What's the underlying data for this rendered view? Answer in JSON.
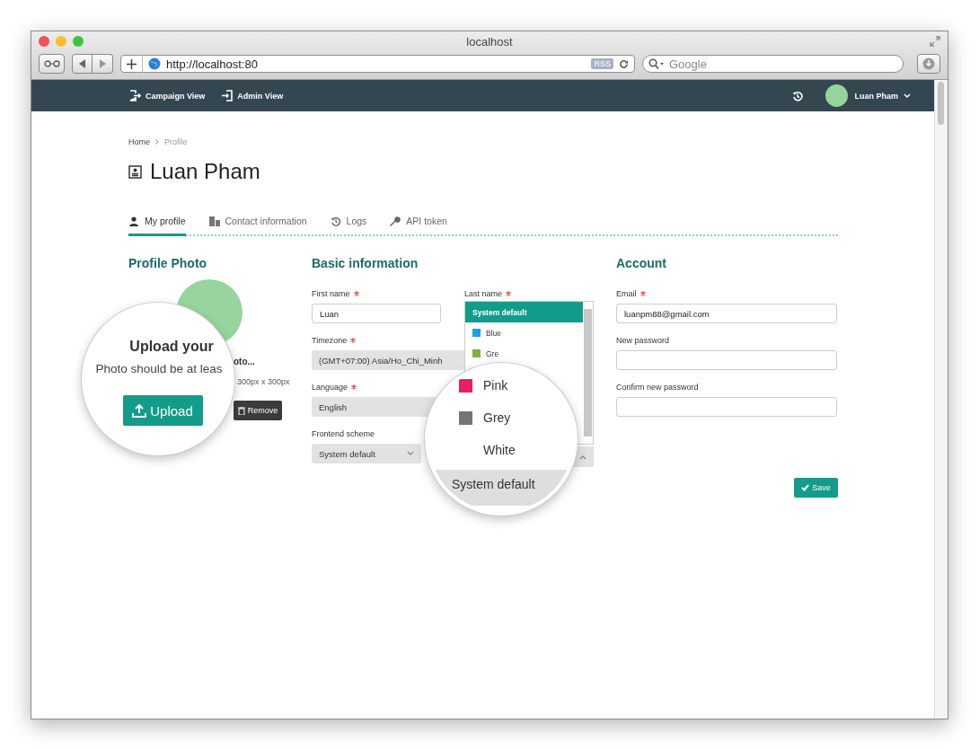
{
  "browser": {
    "title": "localhost",
    "url": "http://localhost:80",
    "rss": "RSS",
    "search_placeholder": "Google"
  },
  "navbar": {
    "links": [
      {
        "label": "Campaign View",
        "kind": "exit"
      },
      {
        "label": "Admin View",
        "kind": "enter"
      }
    ],
    "user": "Luan Pham"
  },
  "breadcrumb": [
    "Home",
    "Profile"
  ],
  "page_title": "Luan Pham",
  "tabs": [
    {
      "label": "My profile",
      "selected": true,
      "kind": "user"
    },
    {
      "label": "Contact information",
      "selected": false,
      "kind": "building"
    },
    {
      "label": "Logs",
      "selected": false,
      "kind": "history"
    },
    {
      "label": "API token",
      "selected": false,
      "kind": "key"
    }
  ],
  "profile_photo": {
    "heading": "Profile Photo",
    "magnifier_title": "Upload your",
    "magnifier_hint": "Photo should be at leas",
    "upload_button": "Upload",
    "caption_fragment": "oto...",
    "size_hint": "300px x 300px",
    "remove_button": "Remove"
  },
  "basic": {
    "heading": "Basic information",
    "fields": [
      {
        "label": "First name",
        "required": true,
        "kind": "input",
        "value": "Luan"
      },
      {
        "label": "Last name",
        "required": true,
        "kind": "input"
      },
      {
        "label": "Timezone",
        "required": true,
        "kind": "select",
        "value": "(GMT+07:00) Asia/Ho_Chi_Minh"
      },
      {
        "label": "Language",
        "required": true,
        "kind": "select",
        "value": "English"
      },
      {
        "label": "Frontend scheme",
        "required": false,
        "kind": "select_half",
        "value": "System default"
      }
    ]
  },
  "scheme_dropdown": {
    "options": [
      {
        "label": "System default",
        "selected": true
      },
      {
        "label": "Blue",
        "selected": false,
        "color": "#1ba1e2"
      },
      {
        "label": "Gre",
        "selected": false,
        "color": "#7cb342"
      }
    ]
  },
  "magnifier": {
    "options": [
      {
        "label": "Pink",
        "color": "#e91e63"
      },
      {
        "label": "Grey",
        "color": "#757575"
      },
      {
        "label": "White"
      }
    ],
    "select_value": "System default"
  },
  "account": {
    "heading": "Account",
    "fields": [
      {
        "label": "Email",
        "required": true,
        "value": "luanpm88@gmail.com"
      },
      {
        "label": "New password",
        "required": false
      },
      {
        "label": "Confirm new password",
        "required": false
      }
    ]
  },
  "save_button": "Save"
}
